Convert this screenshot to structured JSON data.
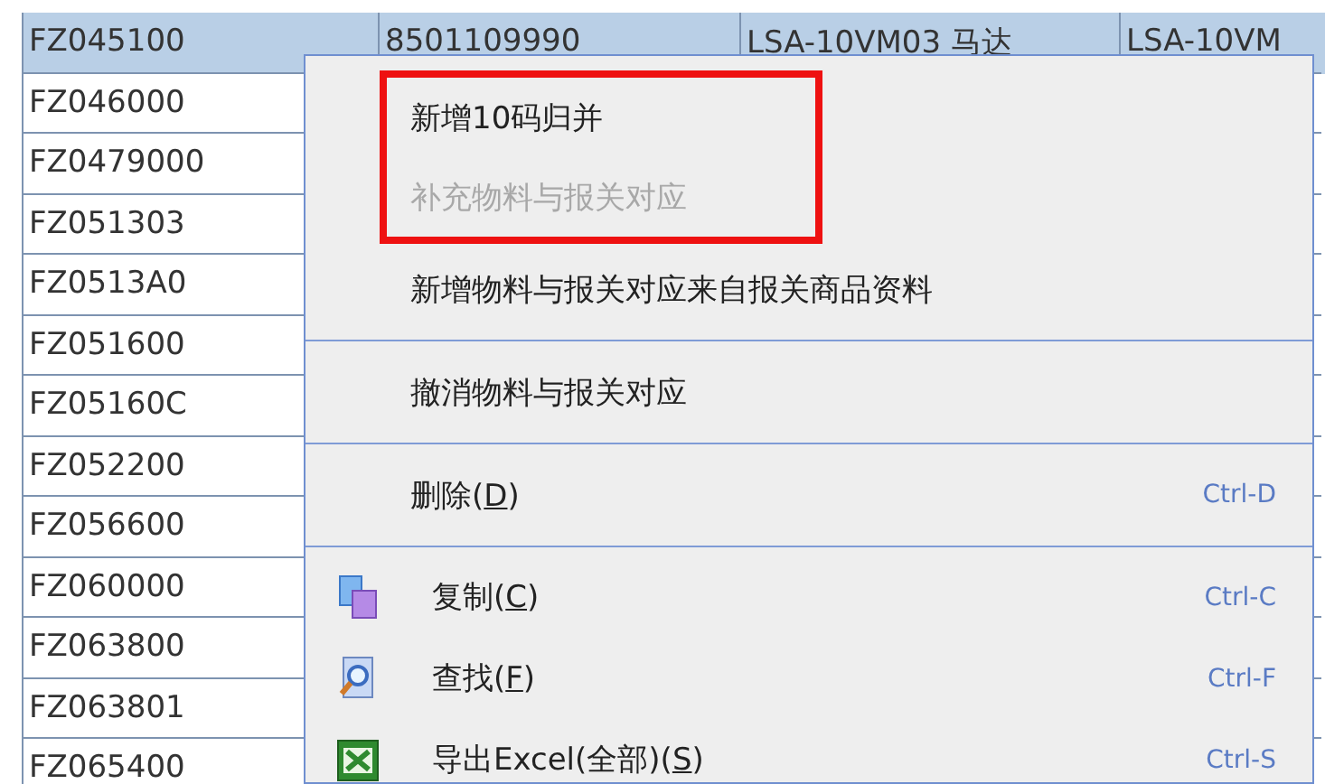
{
  "table": {
    "rows": [
      {
        "selected": true,
        "cells": [
          "FZ045100",
          "8501109990",
          "LSA-10VM03 马达",
          "LSA-10VM"
        ]
      },
      {
        "selected": false,
        "cells": [
          "FZ046000"
        ]
      },
      {
        "selected": false,
        "cells": [
          "FZ0479000"
        ]
      },
      {
        "selected": false,
        "cells": [
          "FZ051303"
        ]
      },
      {
        "selected": false,
        "cells": [
          "FZ0513A0"
        ]
      },
      {
        "selected": false,
        "cells": [
          "FZ051600"
        ]
      },
      {
        "selected": false,
        "cells": [
          "FZ05160C"
        ]
      },
      {
        "selected": false,
        "cells": [
          "FZ052200"
        ]
      },
      {
        "selected": false,
        "cells": [
          "FZ056600"
        ]
      },
      {
        "selected": false,
        "cells": [
          "FZ060000"
        ]
      },
      {
        "selected": false,
        "cells": [
          "FZ063800"
        ]
      },
      {
        "selected": false,
        "cells": [
          "FZ063801"
        ]
      },
      {
        "selected": false,
        "cells": [
          "FZ065400"
        ]
      }
    ]
  },
  "context_menu": {
    "items": [
      {
        "kind": "item",
        "label": "新增10码归并",
        "disabled": false,
        "highlighted": true
      },
      {
        "kind": "item",
        "label": "补充物料与报关对应",
        "disabled": true,
        "highlighted": true
      },
      {
        "kind": "item",
        "label": "新增物料与报关对应来自报关商品资料",
        "disabled": false,
        "highlighted": false
      },
      {
        "kind": "separator"
      },
      {
        "kind": "item",
        "label": "撤消物料与报关对应",
        "disabled": false,
        "highlighted": false
      },
      {
        "kind": "separator"
      },
      {
        "kind": "item",
        "label": "删除(",
        "mnemonic": "D",
        "label_end": ")",
        "shortcut": "Ctrl-D",
        "disabled": false,
        "highlighted": false
      },
      {
        "kind": "separator"
      },
      {
        "kind": "copy",
        "label": "复制(",
        "mnemonic": "C",
        "label_end": ")",
        "shortcut": "Ctrl-C",
        "disabled": false,
        "highlighted": false
      },
      {
        "kind": "find",
        "label": "查找(",
        "mnemonic": "F",
        "label_end": ")",
        "shortcut": "Ctrl-F",
        "disabled": false,
        "highlighted": false
      },
      {
        "kind": "export",
        "label": "导出Excel(全部)(",
        "mnemonic": "S",
        "label_end": ")",
        "shortcut": "Ctrl-S",
        "disabled": false,
        "highlighted": false
      }
    ]
  }
}
